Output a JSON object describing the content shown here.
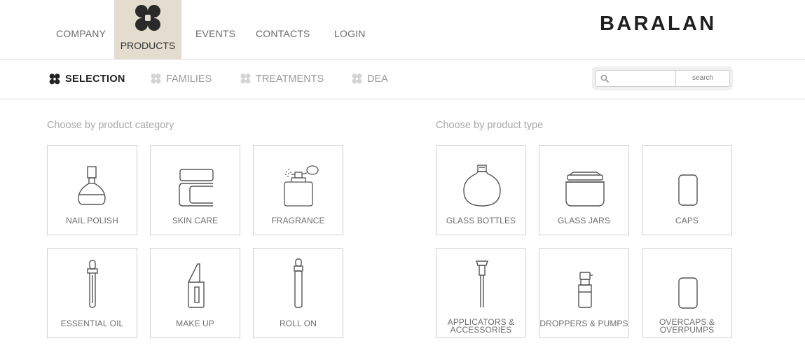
{
  "header": {
    "brand": "BARALAN",
    "nav": [
      "COMPANY",
      "PRODUCTS",
      "EVENTS",
      "CONTACTS",
      "LOGIN"
    ],
    "active_nav": "PRODUCTS"
  },
  "subnav": {
    "items": [
      "SELECTION",
      "FAMILIES",
      "TREATMENTS",
      "DEA"
    ],
    "active": "SELECTION"
  },
  "search": {
    "placeholder": "",
    "button_label": "search"
  },
  "category_section": {
    "title": "Choose by product category",
    "cards": [
      {
        "label": "NAIL POLISH",
        "icon": "nail-polish-icon"
      },
      {
        "label": "SKIN CARE",
        "icon": "skin-care-icon"
      },
      {
        "label": "FRAGRANCE",
        "icon": "fragrance-icon"
      },
      {
        "label": "ESSENTIAL OIL",
        "icon": "essential-oil-icon"
      },
      {
        "label": "MAKE UP",
        "icon": "make-up-icon"
      },
      {
        "label": "ROLL ON",
        "icon": "roll-on-icon"
      }
    ]
  },
  "type_section": {
    "title": "Choose by product type",
    "cards": [
      {
        "label": "GLASS BOTTLES",
        "icon": "glass-bottle-icon"
      },
      {
        "label": "GLASS JARS",
        "icon": "glass-jar-icon"
      },
      {
        "label": "CAPS",
        "icon": "cap-icon"
      },
      {
        "label": "APPLICATORS & ACCESSORIES",
        "icon": "applicator-icon"
      },
      {
        "label": "DROPPERS & PUMPS",
        "icon": "pump-icon"
      },
      {
        "label": "OVERCAPS & OVERPUMPS",
        "icon": "overcap-icon"
      }
    ]
  }
}
